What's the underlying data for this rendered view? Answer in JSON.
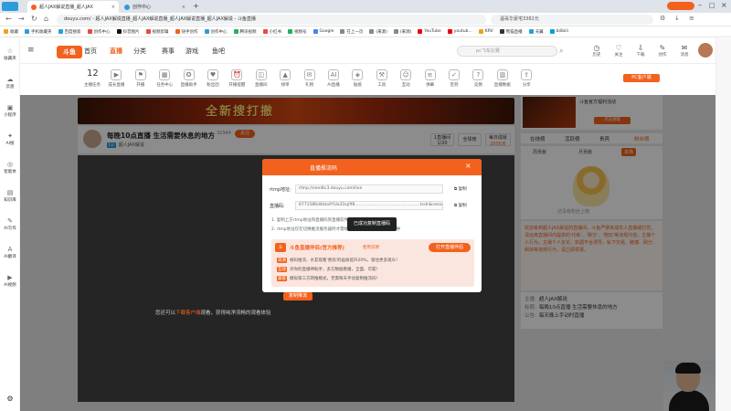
{
  "browser": {
    "tabs": [
      {
        "label": "超人JAX解说直播_超人JAX",
        "active": true
      },
      {
        "label": "创作中心",
        "active": false
      }
    ],
    "new_tab": "+",
    "url": "douyu.com/ - 超人JAX解说直播_超人JAX解说直播_超人JAX解说直播_超人JAX解说 - 斗鱼直播",
    "search_placeholder": "温哥华豪宅3382元",
    "bookmarks": [
      "收藏",
      "手机收藏夹",
      "百度搜索",
      "创作中心",
      "抖音图片",
      "视频剪辑",
      "快手创作",
      "创作中心",
      "腾讯视频",
      "小红书",
      "视频号",
      "Google",
      "在上一页",
      "(来源)",
      "(来源)",
      "YouTube",
      "youtub...",
      "KRV",
      "熊猫直播",
      "天翼",
      "bilibili"
    ],
    "sidebar": [
      "收藏夹",
      "云盘",
      "小程序",
      "AI搜",
      "智能体",
      "知识库",
      "AI写作",
      "AI翻译",
      "AI视频"
    ]
  },
  "site": {
    "logo": "斗鱼",
    "nav": [
      "首页",
      "直播",
      "分类",
      "赛事",
      "游戏",
      "鱼吧"
    ],
    "nav_active": 1,
    "search_placeholder": "pc飞车比赛",
    "header_icons": [
      "历史",
      "关注",
      "下载",
      "创作",
      "消息"
    ],
    "categories": [
      {
        "label": "主播任务",
        "top": "12"
      },
      {
        "label": "成长直播"
      },
      {
        "label": "开播"
      },
      {
        "label": "任务中心"
      },
      {
        "label": "直播助手"
      },
      {
        "label": "粉丝团"
      },
      {
        "label": "开播提醒"
      },
      {
        "label": "直播间"
      },
      {
        "label": "榜单"
      },
      {
        "label": "礼物"
      },
      {
        "label": "AI直播"
      },
      {
        "label": "贴纸"
      },
      {
        "label": "工具"
      },
      {
        "label": "互动"
      },
      {
        "label": "弹幕"
      },
      {
        "label": "签到"
      },
      {
        "label": "竞猜"
      },
      {
        "label": "直播数据"
      },
      {
        "label": "分享"
      }
    ],
    "pc_button": "PC客户端"
  },
  "banner": {
    "text": "全新搜打撤"
  },
  "room": {
    "title": "每晚10点直播 生活需要休息的地方",
    "streamer": "超人JAX解说",
    "follow_label": "关注",
    "fans": "32944",
    "rank_label": "1直播间",
    "rank_value": "1/20",
    "category_btn": "全球榜",
    "daily_label": "每日成就",
    "daily_value": "2000天"
  },
  "player": {
    "obs_button": "复制推流",
    "status_prefix": "您还可以",
    "status_highlight": "下载客户端",
    "status_suffix": "观看，获得纯净流畅的观看体验"
  },
  "modal": {
    "title": "直播推流码",
    "close": "×",
    "rtmp_label": "rtmp地址:",
    "rtmp_value": "rtmp://sendtc3.douyu.com/live",
    "code_label": "直播码:",
    "code_value": "6771586d4kto0YUo31kjiff8..................................................tcdn&recognition",
    "copy": "复制",
    "note1": "1. 复制上方rtmp地址和直播码到直播软件(如OBS)中对应位置",
    "note2": "2. rtmp地址仅在切换推流服务器时才需修改，直播码每次开播后5分钟",
    "toast": "已成功复制直播码",
    "helper_title": "斗鱼直播伴侣(官方推荐)",
    "helper_version": "使用说明",
    "helper_button": "打开直播伴侣",
    "helper_rows": [
      {
        "tag": "高清",
        "text": "帧码推流、水友观看'更高'的画质提升20%，留住更多观众！"
      },
      {
        "tag": "互动",
        "text": "许你的直播神助手，多方数据看播，全面、可靠！"
      },
      {
        "tag": "兼容",
        "text": "模拟第三方转推模式，无需每天手动复制推流码！"
      }
    ]
  },
  "right": {
    "ad_text": "斗鱼官方福利活动",
    "ad_button": "点击领取",
    "tabs": [
      "在线榜",
      "活跃榜",
      "贵宾",
      "粉丝榜"
    ],
    "subtabs": [
      "周贡献",
      "月贡献",
      "本场"
    ],
    "empty_text": "还没有粉丝上榜",
    "announce": "欢迎来到超人JAX解说的直播间，斗鱼严禁未成年人直播或打赏，请远离直播间内提供的'代练'、'刷分'、'陪玩'等违规内容，主播个人行为，主播个人言论，如遇平台诱导，私下交易、赌博、刷分、刷单等违规行为，请立即举报。",
    "info": [
      {
        "k": "主播:",
        "v": "超人JAX解说"
      },
      {
        "k": "标题:",
        "v": "每晚10点直播 生活需要休息的地方"
      },
      {
        "k": "公告:",
        "v": "每天晚上手动时直播"
      }
    ]
  }
}
